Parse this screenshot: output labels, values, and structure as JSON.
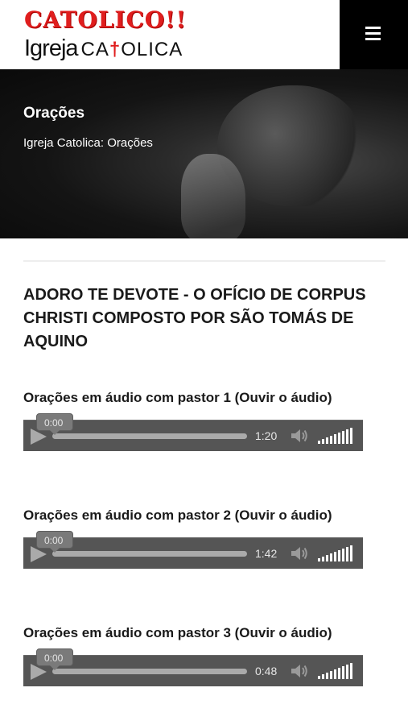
{
  "header": {
    "logo_top": "CATOLICO!!",
    "logo_igreja": "Igreja",
    "logo_catolica_before": "CA",
    "logo_catolica_cross": "†",
    "logo_catolica_after": "OLICA",
    "menu_icon": "hamburger-icon"
  },
  "hero": {
    "title": "Orações",
    "breadcrumb": "Igreja Catolica: Orações"
  },
  "article": {
    "title": "ADORO TE DEVOTE - O OFÍCIO DE CORPUS CHRISTI COMPOSTO POR SÃO TOMÁS DE AQUINO"
  },
  "audios": [
    {
      "label": "Orações em áudio com pastor 1 (Ouvir o áudio)",
      "current_time": "0:00",
      "duration": "1:20"
    },
    {
      "label": "Orações em áudio com pastor 2 (Ouvir o áudio)",
      "current_time": "0:00",
      "duration": "1:42"
    },
    {
      "label": "Orações em áudio com pastor 3 (Ouvir o áudio)",
      "current_time": "0:00",
      "duration": "0:48"
    }
  ],
  "colors": {
    "brand_red": "#e01e1e",
    "menu_bg": "#000000",
    "player_bg": "#555555"
  }
}
